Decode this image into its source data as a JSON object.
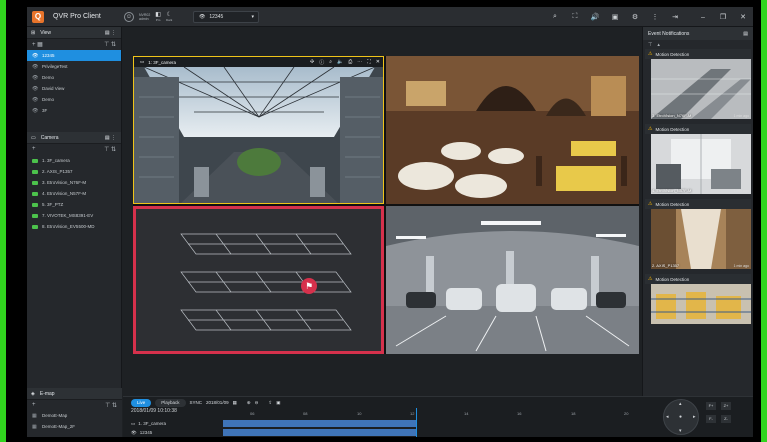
{
  "app": {
    "title": "QVR Pro Client",
    "logo_letter": "Q"
  },
  "user": {
    "line1": "NVR02",
    "line2": "admin"
  },
  "mini_controls": [
    {
      "glyph": "◧",
      "label": "Pro"
    },
    {
      "glyph": "☾",
      "label": "Dark"
    }
  ],
  "view_selector": {
    "value": "12345"
  },
  "toolbar_icons": [
    "search-icon",
    "fullscreen-icon",
    "volume-icon",
    "record-icon",
    "settings-icon",
    "more-icon",
    "logout-icon"
  ],
  "window_controls": [
    "minimize-icon",
    "restore-icon",
    "close-icon"
  ],
  "view_panel": {
    "title": "View",
    "items": [
      {
        "label": "12345",
        "selected": true
      },
      {
        "label": "PrivilegeTest",
        "selected": false
      },
      {
        "label": "Demo",
        "selected": false
      },
      {
        "label": "David View",
        "selected": false
      },
      {
        "label": "Demo",
        "selected": false
      },
      {
        "label": "3F",
        "selected": false
      }
    ]
  },
  "camera_panel": {
    "title": "Camera",
    "items": [
      {
        "label": "1. 3F_camera"
      },
      {
        "label": "2. AXIS_P1357"
      },
      {
        "label": "3. EtroVision_N76F-M"
      },
      {
        "label": "4. EtroVision_N57F-M"
      },
      {
        "label": "5. 3F_PTZ"
      },
      {
        "label": "7. VIVOTEK_MS8391-EV"
      },
      {
        "label": "8. EtroVision_EV5500-MD"
      }
    ]
  },
  "emap_panel": {
    "title": "E-map",
    "items": [
      {
        "label": "DemoE-Map"
      },
      {
        "label": "DemoE-Map_2F"
      }
    ]
  },
  "active_tile": {
    "label": "1: 3F_camera"
  },
  "event_panel": {
    "title": "Event Notifications",
    "events": [
      {
        "title": "Motion Detection",
        "camera": "3. EtroVision_N76F-M",
        "time": "1 min ago"
      },
      {
        "title": "Motion Detection",
        "camera": "4. EtroVision_N57F-M",
        "time": "1 min ago"
      },
      {
        "title": "Motion Detection",
        "camera": "2. AXIS_P1357",
        "time": "1 min ago"
      },
      {
        "title": "Motion Detection",
        "camera": "",
        "time": ""
      }
    ]
  },
  "timeline": {
    "live_label": "Live",
    "playback_label": "Playback",
    "sync_label": "SYNC",
    "date": "2018/01/09",
    "timestamp": "2018/01/09 10:10:38",
    "ticks": [
      "06",
      "08",
      "10",
      "12",
      "14",
      "16",
      "18",
      "20"
    ],
    "tracks": [
      {
        "label": "1. 3F_camera",
        "start_fraction": 0.0,
        "end_fraction": 0.45
      },
      {
        "label": "12345",
        "start_fraction": 0.0,
        "end_fraction": 0.45
      }
    ],
    "cursor_fraction": 0.45
  },
  "colors": {
    "accent": "#1f8fe0",
    "active_tile_border": "#f0c419",
    "alert_tile_border": "#d6314c",
    "warning": "#f5b300",
    "camera_online": "#4cc24c"
  }
}
